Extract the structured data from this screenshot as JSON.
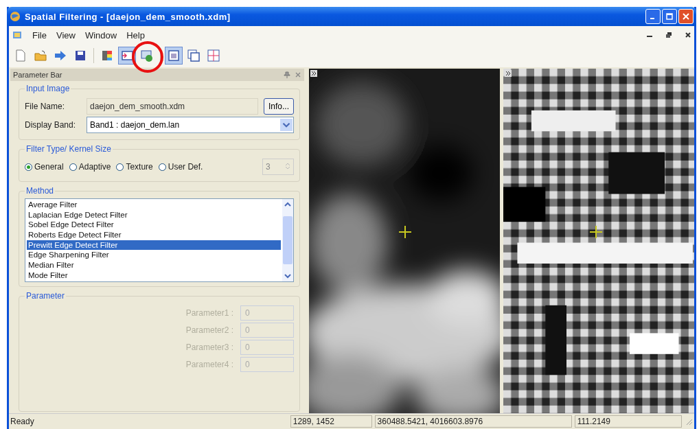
{
  "window": {
    "title": "Spatial Filtering - [daejon_dem_smooth.xdm]"
  },
  "menu": [
    {
      "label": "File"
    },
    {
      "label": "View"
    },
    {
      "label": "Window"
    },
    {
      "label": "Help"
    }
  ],
  "toolbar": [
    {
      "kind": "new",
      "pressed": false
    },
    {
      "kind": "open",
      "pressed": false
    },
    {
      "kind": "forward",
      "pressed": false
    },
    {
      "kind": "save",
      "pressed": false
    },
    {
      "kind": "palette",
      "pressed": false
    },
    {
      "kind": "import",
      "pressed": true
    },
    {
      "kind": "export",
      "pressed": false
    },
    {
      "kind": "single",
      "pressed": true
    },
    {
      "kind": "double",
      "pressed": false
    },
    {
      "kind": "grid",
      "pressed": false
    }
  ],
  "parameter_bar": {
    "title": "Parameter Bar",
    "input_image": {
      "title": "Input Image",
      "file_name_label": "File Name:",
      "file_name": "daejon_dem_smooth.xdm",
      "info_button": "Info...",
      "display_band_label": "Display Band:",
      "display_band": "Band1 : daejon_dem.lan"
    },
    "filter_type": {
      "title": "Filter Type/ Kernel Size",
      "kernel_size": "3",
      "options": [
        {
          "label": "General",
          "selected": true
        },
        {
          "label": "Adaptive",
          "selected": false
        },
        {
          "label": "Texture",
          "selected": false
        },
        {
          "label": "User Def.",
          "selected": false
        }
      ]
    },
    "method": {
      "title": "Method",
      "items": [
        {
          "label": "Average Filter",
          "selected": false
        },
        {
          "label": "Laplacian Edge Detect Filter",
          "selected": false
        },
        {
          "label": "Sobel Edge Detect Filter",
          "selected": false
        },
        {
          "label": "Roberts Edge Detect Filter",
          "selected": false
        },
        {
          "label": "Prewitt Edge Detect Filter",
          "selected": true
        },
        {
          "label": "Edge Sharpening Filter",
          "selected": false
        },
        {
          "label": "Median Filter",
          "selected": false
        },
        {
          "label": "Mode Filter",
          "selected": false
        }
      ]
    },
    "parameter": {
      "title": "Parameter",
      "disabled": true,
      "fields": [
        {
          "label": "Parameter1 :",
          "value": "0"
        },
        {
          "label": "Parameter2 :",
          "value": "0"
        },
        {
          "label": "Parameter3 :",
          "value": "0"
        },
        {
          "label": "Parameter4 :",
          "value": "0"
        }
      ]
    }
  },
  "status_bar": {
    "message": "Ready",
    "pixel": "1289, 1452",
    "coords": "360488.5421, 4016603.8976",
    "value": "111.2149"
  }
}
